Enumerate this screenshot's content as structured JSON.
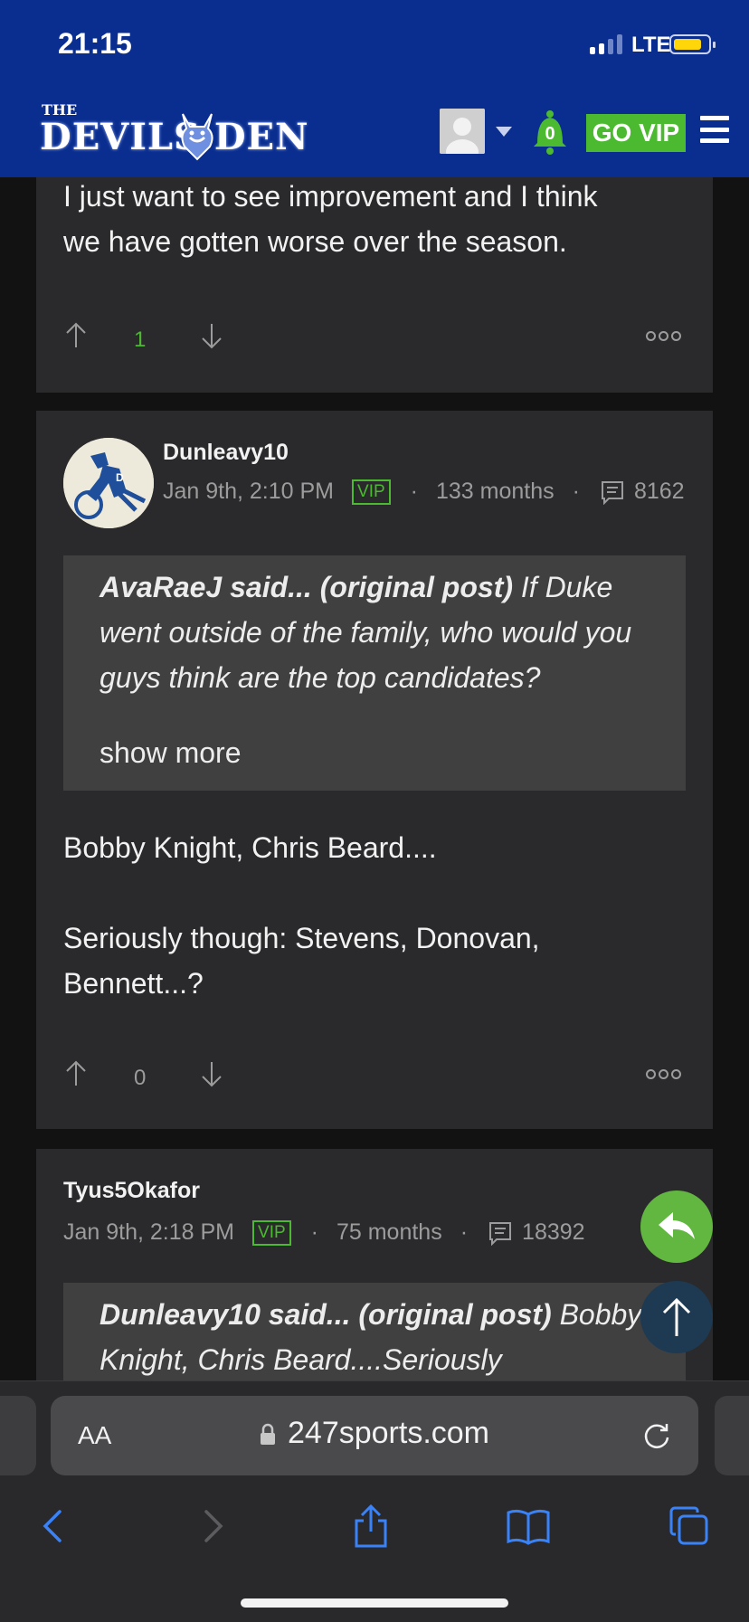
{
  "status_bar": {
    "time": "21:15",
    "network": "LTE"
  },
  "header": {
    "logo_small": "THE",
    "logo_main": "DEVILS  DEN",
    "notifications_count": "0",
    "go_vip": "GO VIP"
  },
  "posts": [
    {
      "body": "I just want to see improvement and I think\nwe have gotten worse over the season.",
      "votes": "1"
    },
    {
      "author": "Dunleavy10",
      "date": "Jan 9th, 2:10 PM",
      "badge": "VIP",
      "tenure": "133 months",
      "post_count": "8162",
      "quote": {
        "attribution": "AvaRaeJ said... (original post)",
        "text": " If Duke went outside of the family, who would you guys think are the top candidates?",
        "show_more": "show more"
      },
      "body": "Bobby Knight, Chris Beard....\n\nSeriously though: Stevens, Donovan,\nBennett...?",
      "votes": "0"
    },
    {
      "author": "Tyus5Okafor",
      "date": "Jan 9th, 2:18 PM",
      "badge": "VIP",
      "tenure": "75 months",
      "post_count": "18392",
      "quote": {
        "attribution": "Dunleavy10 said... (original post)",
        "text": " Bobby Knight, Chris Beard....Seriously"
      }
    }
  ],
  "browser": {
    "text_size_label": "AA",
    "url": "247sports.com"
  },
  "colors": {
    "header_blue": "#0a2e8f",
    "accent_green": "#4cba30",
    "card_bg": "#2a2a2c",
    "quote_bg": "#404040",
    "ios_blue": "#3a82f7"
  },
  "icons": [
    "signal-icon",
    "battery-icon",
    "devil-logo-icon",
    "bell-icon",
    "hamburger-menu-icon",
    "upvote-arrow-icon",
    "downvote-arrow-icon",
    "more-options-icon",
    "comment-count-icon",
    "reply-icon",
    "scroll-top-icon",
    "lock-icon",
    "reload-icon",
    "back-icon",
    "forward-icon",
    "share-icon",
    "bookmarks-icon",
    "tabs-icon"
  ]
}
